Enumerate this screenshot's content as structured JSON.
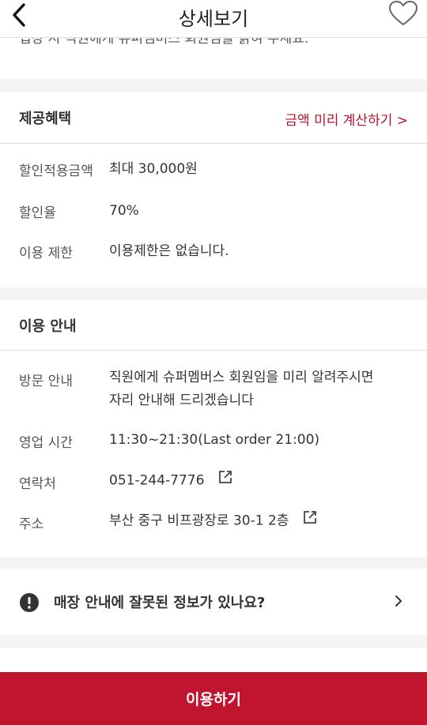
{
  "header": {
    "title": "상세보기"
  },
  "top_cut_text": "입장 시 직원에게 슈퍼멤버스 회원임을 밝혀 주세요.",
  "benefit": {
    "title": "제공혜택",
    "calc_link": "금액 미리 계산하기 >",
    "rows": [
      {
        "label": "할인적용금액",
        "value": "최대 30,000원"
      },
      {
        "label": "할인율",
        "value": "70%"
      },
      {
        "label": "이용 제한",
        "value": "이용제한은 없습니다."
      }
    ]
  },
  "usage": {
    "title": "이용 안내",
    "visit_label": "방문 안내",
    "visit_line1": "직원에게 슈퍼멤버스 회원임을 미리 알려주시면",
    "visit_line2": "자리 안내해 드리겠습니다",
    "hours_label": "영업 시간",
    "hours_value": "11:30~21:30(Last order 21:00)",
    "contact_label": "연락처",
    "contact_value": "051-244-7776",
    "address_label": "주소",
    "address_value": "부산 중구 비프광장로 30-1 2층"
  },
  "report": {
    "text": "매장 안내에 잘못된 정보가 있나요?"
  },
  "cta": {
    "label": "이용하기"
  },
  "colors": {
    "accent": "#c0142f",
    "link": "#b6122c"
  }
}
